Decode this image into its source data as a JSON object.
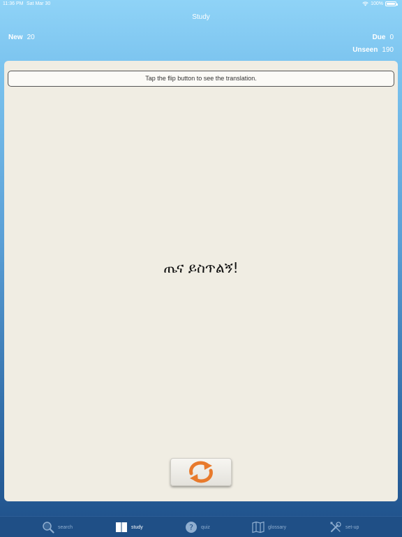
{
  "status_bar": {
    "time": "11:36 PM",
    "date": "Sat Mar 30",
    "battery": "100%"
  },
  "nav": {
    "title": "Study"
  },
  "counters": {
    "new_label": "New",
    "new_value": "20",
    "due_label": "Due",
    "due_value": "0",
    "unseen_label": "Unseen",
    "unseen_value": "190"
  },
  "card": {
    "hint": "Tap the flip button to see the translation.",
    "phrase": "ጤና ይስጥልኝ!"
  },
  "tabs": [
    {
      "label": "search",
      "icon": "search-icon",
      "active": false
    },
    {
      "label": "study",
      "icon": "book-icon",
      "active": true
    },
    {
      "label": "quiz",
      "icon": "question-icon",
      "active": false
    },
    {
      "label": "glossary",
      "icon": "map-icon",
      "active": false
    },
    {
      "label": "set-up",
      "icon": "tools-icon",
      "active": false
    }
  ],
  "colors": {
    "flip_icon": "#e87a2c",
    "card_bg": "#f0ede3",
    "tab_bar": "#1f4f86"
  }
}
